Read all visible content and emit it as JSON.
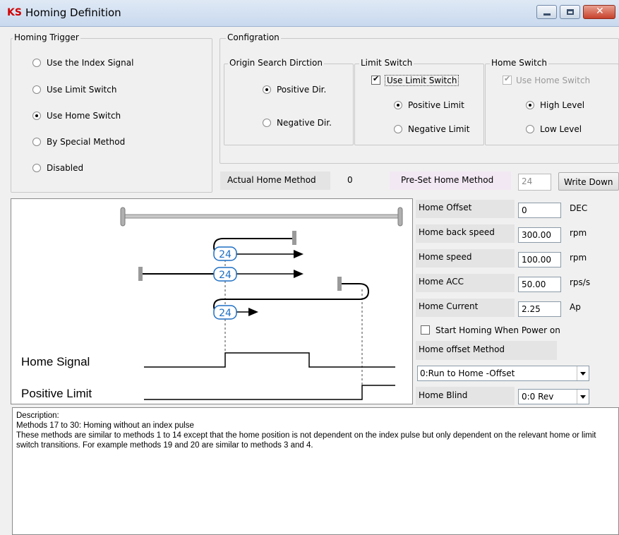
{
  "window": {
    "logo": "KS",
    "title": "Homing Definition"
  },
  "homing_trigger": {
    "label": "Homing Trigger",
    "options": [
      {
        "label": "Use the Index Signal",
        "selected": false
      },
      {
        "label": "Use Limit Switch",
        "selected": false
      },
      {
        "label": "Use Home Switch",
        "selected": true
      },
      {
        "label": "By Special Method",
        "selected": false
      },
      {
        "label": "Disabled",
        "selected": false
      }
    ]
  },
  "configuration": {
    "label": "Configration",
    "origin_search": {
      "label": "Origin Search Dirction",
      "positive": "Positive Dir.",
      "negative": "Negative Dir.",
      "selected": "positive"
    },
    "limit_switch": {
      "label": "Limit Switch",
      "use_label": "Use Limit Switch",
      "use_checked": true,
      "positive": "Positive Limit",
      "negative": "Negative Limit",
      "selected": "positive"
    },
    "home_switch": {
      "label": "Home Switch",
      "use_label": "Use Home Switch",
      "use_checked": true,
      "use_disabled": true,
      "high": "High Level",
      "low": "Low Level",
      "selected": "high"
    },
    "actual_home_method_label": "Actual Home Method",
    "actual_home_method_value": "0",
    "preset_home_method_label": "Pre-Set Home Method",
    "preset_home_method_value": "24",
    "write_down_label": "Write Down"
  },
  "diagram": {
    "method_number": "24",
    "home_signal_label": "Home Signal",
    "positive_limit_label": "Positive Limit"
  },
  "parameters": {
    "home_offset": {
      "label": "Home Offset",
      "value": "0",
      "unit": "DEC"
    },
    "home_back_speed": {
      "label": "Home back speed",
      "value": "300.00",
      "unit": "rpm"
    },
    "home_speed": {
      "label": "Home speed",
      "value": "100.00",
      "unit": "rpm"
    },
    "home_acc": {
      "label": "Home ACC",
      "value": "50.00",
      "unit": "rps/s"
    },
    "home_current": {
      "label": "Home Current",
      "value": "2.25",
      "unit": "Ap"
    },
    "start_on_power": {
      "label": "Start Homing When Power on",
      "checked": false
    },
    "home_offset_method": {
      "label": "Home offset Method",
      "value": "0:Run to Home -Offset"
    },
    "home_blind": {
      "label": "Home Blind",
      "value": "0:0 Rev"
    }
  },
  "description": {
    "line1": "Description:",
    "line2": "Methods 17 to 30: Homing without an index pulse",
    "line3": "These methods are similar to methods 1 to 14 except that the home position is not dependent on the index pulse but only dependent on the relevant home or limit switch transitions. For example methods 19 and 20 are similar to methods 3 and 4."
  },
  "colors": {
    "accent_blue": "#1e6fc4",
    "logo_red": "#d00000",
    "preset_bg": "#f2e8f4"
  }
}
